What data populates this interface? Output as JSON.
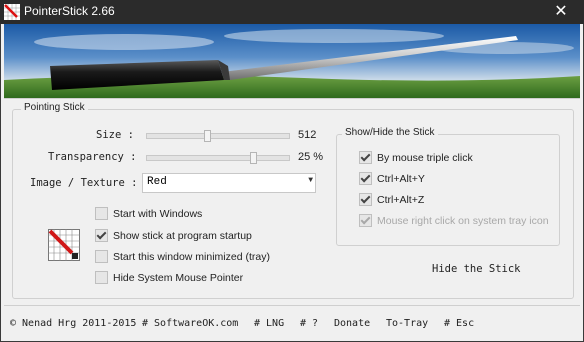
{
  "window": {
    "title": "PointerStick 2.66",
    "close_glyph": "✕",
    "app_icon": "pointer-grid-icon"
  },
  "pointing_stick": {
    "legend": "Pointing Stick",
    "size_label": "Size :",
    "size_value": "512",
    "size_level": 0.43,
    "transparency_label": "Transparency :",
    "transparency_value": "25 %",
    "transparency_level": 0.75,
    "texture_label": "Image / Texture :",
    "texture_value": "Red",
    "dropdown_glyph": "▼"
  },
  "options": [
    {
      "label": "Start with Windows",
      "checked": false
    },
    {
      "label": "Show stick at program startup",
      "checked": true
    },
    {
      "label": "Start this window minimized (tray)",
      "checked": false
    },
    {
      "label": "Hide System Mouse Pointer",
      "checked": false
    }
  ],
  "show_hide": {
    "legend": "Show/Hide the Stick",
    "items": [
      {
        "label": "By mouse triple click",
        "checked": true,
        "disabled": false
      },
      {
        "label": "Ctrl+Alt+Y",
        "checked": true,
        "disabled": false
      },
      {
        "label": "Ctrl+Alt+Z",
        "checked": true,
        "disabled": false
      },
      {
        "label": "Mouse right click on system tray icon",
        "checked": true,
        "disabled": true
      }
    ],
    "hide_button": "Hide the Stick"
  },
  "status_bar": {
    "copyright": "© Nenad Hrg 2011-2015",
    "website": "# SoftwareOK.com",
    "lng": "# LNG",
    "help": "# ?",
    "donate": "Donate",
    "to_tray": "To-Tray",
    "esc": "# Esc"
  },
  "colors": {
    "titlebar_bg": "#2b2b2b",
    "window_bg": "#f0f0f0",
    "sky_top": "#1f5fa8",
    "grass": "#4a8a2a"
  }
}
